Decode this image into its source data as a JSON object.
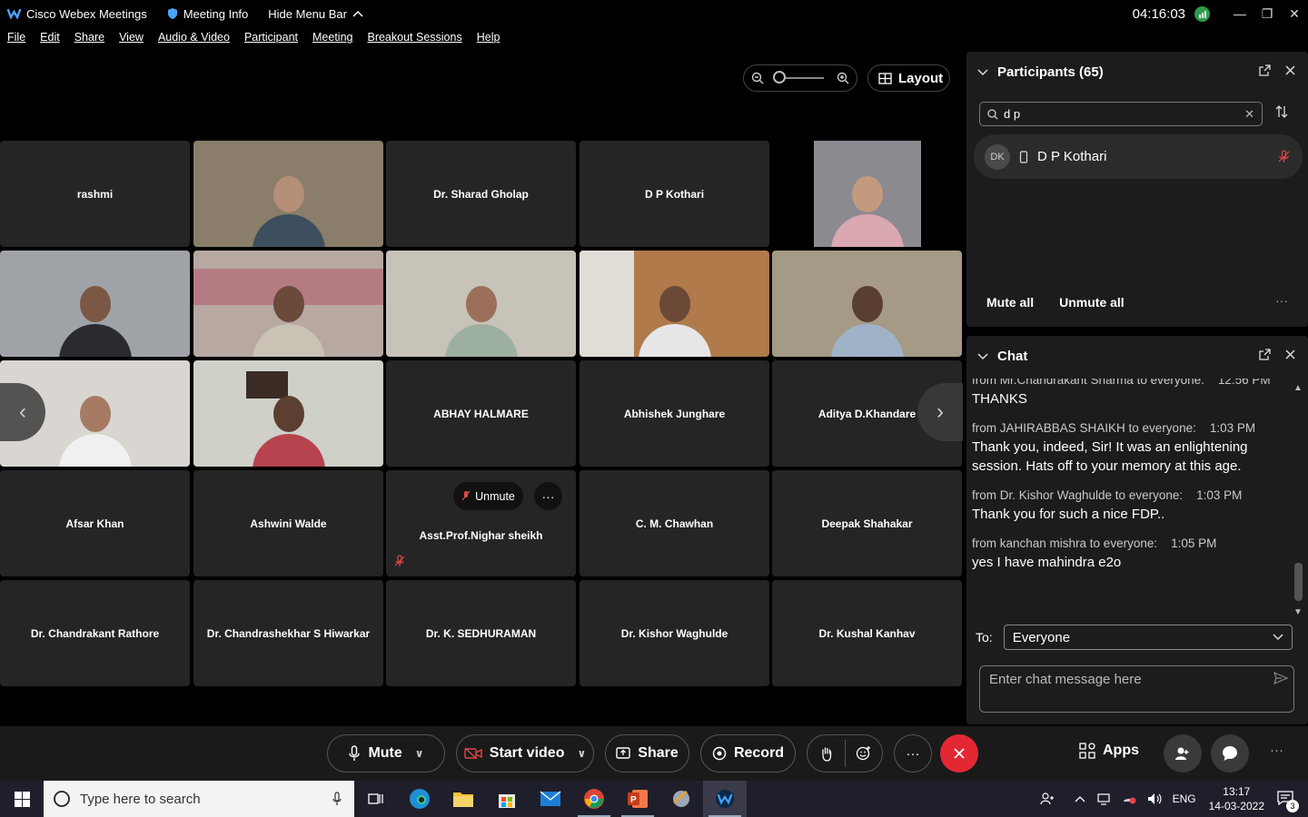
{
  "titlebar": {
    "app_name": "Cisco Webex Meetings",
    "meeting_info": "Meeting Info",
    "hide_menu": "Hide Menu Bar",
    "clock": "04:16:03"
  },
  "menu": [
    "File",
    "Edit",
    "Share",
    "View",
    "Audio & Video",
    "Participant",
    "Meeting",
    "Breakout Sessions",
    "Help"
  ],
  "layout_label": "Layout",
  "tiles": [
    {
      "name": "rashmi"
    },
    {
      "name": ""
    },
    {
      "name": "Dr. Sharad Gholap"
    },
    {
      "name": "D P Kothari"
    },
    {
      "name": ""
    },
    {
      "name": ""
    },
    {
      "name": ""
    },
    {
      "name": ""
    },
    {
      "name": ""
    },
    {
      "name": ""
    },
    {
      "name": ""
    },
    {
      "name": ""
    },
    {
      "name": "ABHAY HALMARE"
    },
    {
      "name": "Abhishek Junghare"
    },
    {
      "name": "Aditya D.Khandare"
    },
    {
      "name": "Afsar Khan"
    },
    {
      "name": "Ashwini Walde"
    },
    {
      "name": "Asst.Prof.Nighar sheikh"
    },
    {
      "name": "C. M. Chawhan"
    },
    {
      "name": "Deepak Shahakar"
    },
    {
      "name": "Dr. Chandrakant Rathore"
    },
    {
      "name": "Dr. Chandrashekhar S Hiwarkar"
    },
    {
      "name": "Dr. K. SEDHURAMAN"
    },
    {
      "name": "Dr. Kishor Waghulde"
    },
    {
      "name": "Dr. Kushal Kanhav"
    }
  ],
  "tile_unmute": "Unmute",
  "participants": {
    "title": "Participants (65)",
    "search_value": "d p",
    "rows": [
      {
        "initials": "DK",
        "name": "D P Kothari"
      }
    ],
    "mute_all": "Mute all",
    "unmute_all": "Unmute all"
  },
  "chat": {
    "title": "Chat",
    "messages": [
      {
        "from": "from Mr.Chandrakant Sharma to everyone:",
        "time": "12:56 PM",
        "text": "THANKS"
      },
      {
        "from": "from JAHIRABBAS SHAIKH to everyone:",
        "time": "1:03 PM",
        "text": "Thank you, indeed, Sir! It was an enlightening session. Hats off to your memory at this age."
      },
      {
        "from": "from Dr. Kishor Waghulde to everyone:",
        "time": "1:03 PM",
        "text": "Thank you for such a nice FDP.."
      },
      {
        "from": "from kanchan mishra to everyone:",
        "time": "1:05 PM",
        "text": "yes I have mahindra e2o"
      }
    ],
    "to_label": "To:",
    "to_value": "Everyone",
    "input_placeholder": "Enter chat message here"
  },
  "controls": {
    "mute": "Mute",
    "start_video": "Start video",
    "share": "Share",
    "record": "Record",
    "apps": "Apps"
  },
  "taskbar": {
    "search_placeholder": "Type here to search",
    "lang": "ENG",
    "time": "13:17",
    "date": "14-03-2022",
    "notif_count": "3"
  },
  "colors": {
    "end_call": "#e32833",
    "panel_bg": "#1c1c1c",
    "tile_bg": "#252525"
  }
}
